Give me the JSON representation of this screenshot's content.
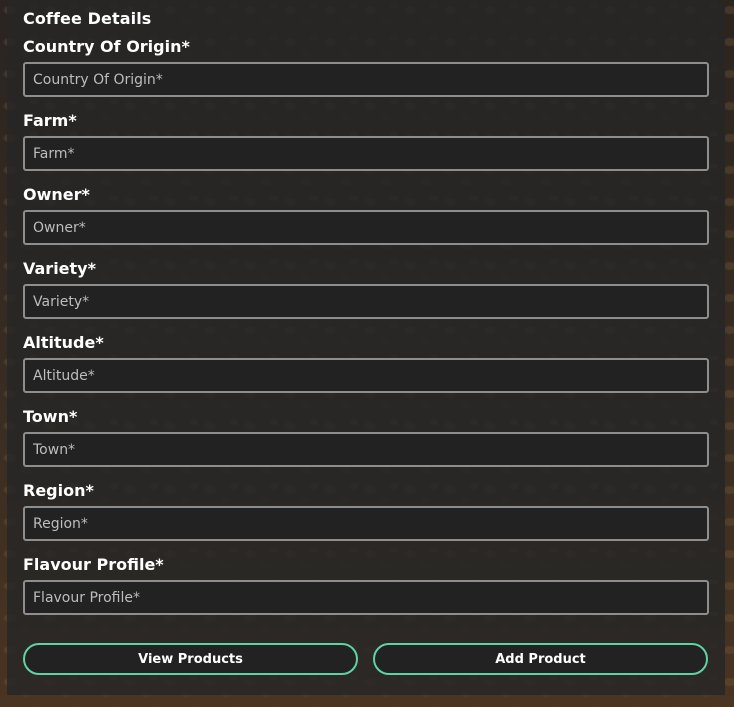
{
  "form": {
    "title": "Coffee Details",
    "fields": [
      {
        "label": "Country Of Origin*",
        "placeholder": "Country Of Origin*"
      },
      {
        "label": "Farm*",
        "placeholder": "Farm*"
      },
      {
        "label": "Owner*",
        "placeholder": "Owner*"
      },
      {
        "label": "Variety*",
        "placeholder": "Variety*"
      },
      {
        "label": "Altitude*",
        "placeholder": "Altitude*"
      },
      {
        "label": "Town*",
        "placeholder": "Town*"
      },
      {
        "label": "Region*",
        "placeholder": "Region*"
      },
      {
        "label": "Flavour Profile*",
        "placeholder": "Flavour Profile*"
      }
    ]
  },
  "actions": {
    "view_products": "View Products",
    "add_product": "Add Product"
  },
  "colors": {
    "panel_bg": "#262626",
    "input_bg": "#222222",
    "input_border": "#8e8e8e",
    "button_border": "#5fd3a4",
    "text": "#ffffff"
  }
}
